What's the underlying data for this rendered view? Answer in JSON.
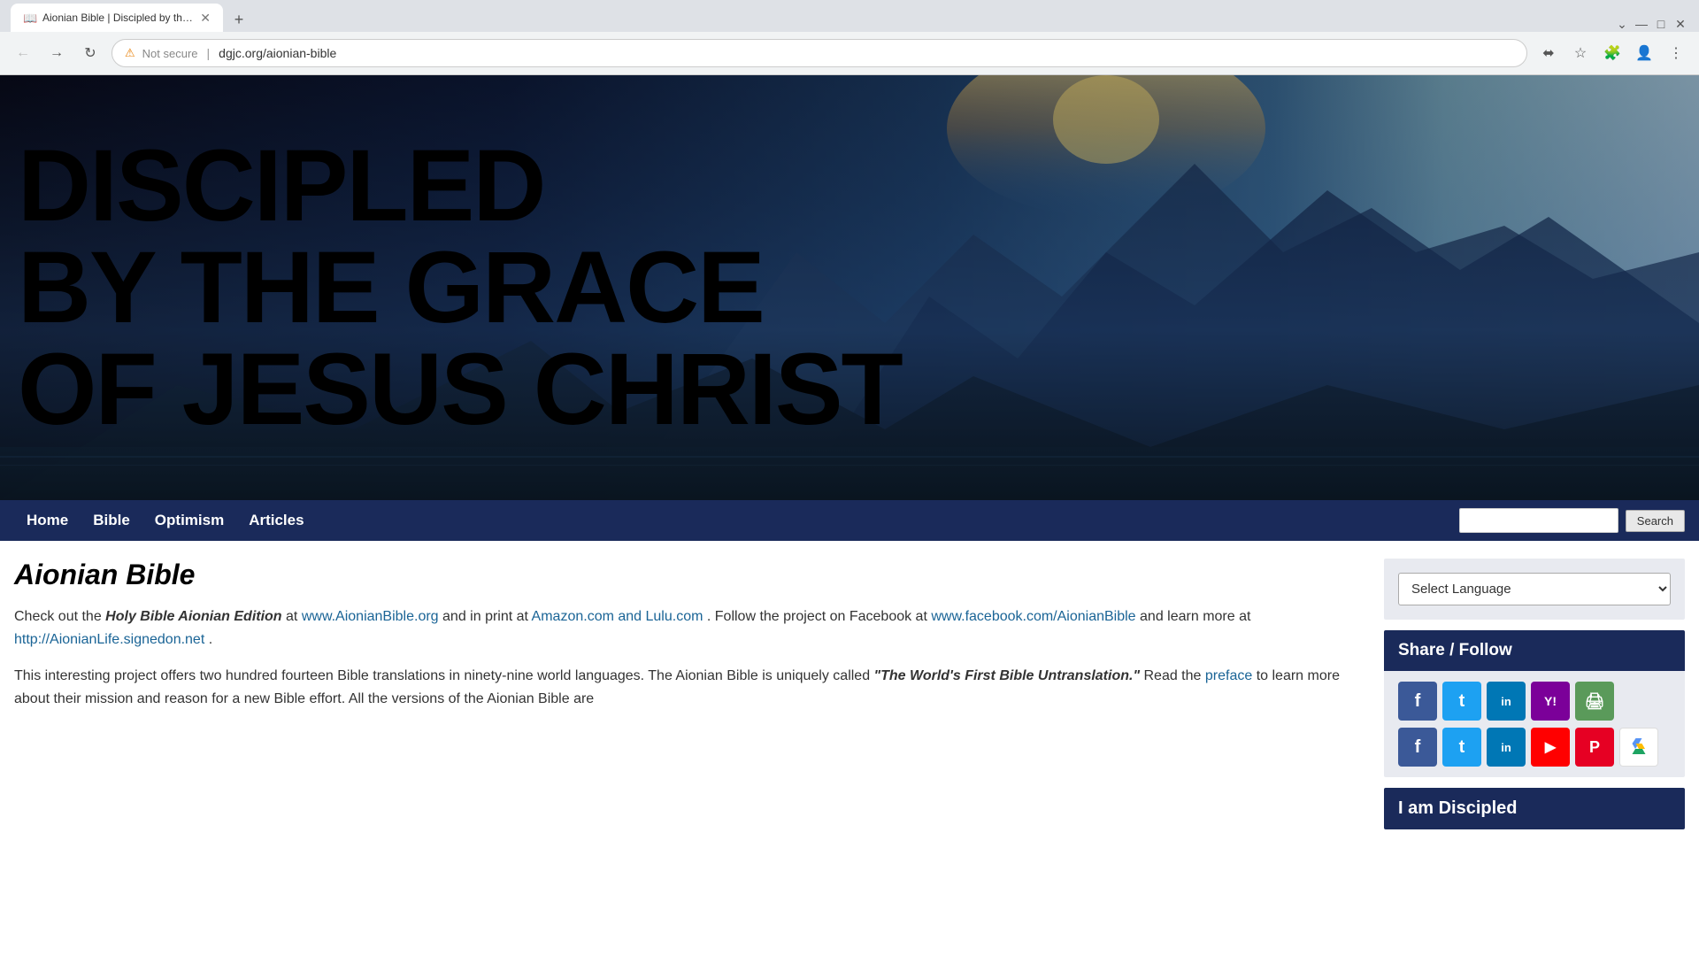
{
  "browser": {
    "tab_title": "Aionian Bible | Discipled by the C",
    "tab_favicon": "📖",
    "url": "dgjc.org/aionian-bible",
    "security_label": "Not secure",
    "new_tab_label": "+"
  },
  "nav": {
    "links": [
      "Home",
      "Bible",
      "Optimism",
      "Articles"
    ],
    "search_placeholder": "",
    "search_btn": "Search"
  },
  "hero": {
    "line1": "DISCIPLED",
    "line2": "BY THE GRACE",
    "line3": "OF JESUS CHRIST"
  },
  "page": {
    "title": "Aionian Bible",
    "para1_before_link1": "Check out the ",
    "para1_italic": "Holy Bible Aionian Edition",
    "para1_mid": " at ",
    "para1_link1": "www.AionianBible.org",
    "para1_mid2": " and in print at ",
    "para1_link2": "Amazon.com and Lulu.com",
    "para1_mid3": ".  Follow the project on Facebook at ",
    "para1_link3": "www.facebook.com/AionianBible",
    "para1_mid4": " and learn more at ",
    "para1_link4": "http://AionianLife.signedon.net",
    "para1_end": ".",
    "para2_start": "This interesting project offers two hundred fourteen Bible translations in ninety-nine world languages.  The Aionian Bible is uniquely called ",
    "para2_italic": "\"The World's First Bible Untranslation.\"",
    "para2_mid": "  Read the ",
    "para2_link": "preface",
    "para2_end": " to learn more about their mission and reason for a new Bible effort.  All the versions of the Aionian Bible are"
  },
  "sidebar": {
    "lang_select_label": "Select Language",
    "share_header": "Share / Follow",
    "discipled_header": "I am Discipled",
    "share_icons_row1": [
      {
        "name": "facebook",
        "label": "f",
        "class": "icon-fb"
      },
      {
        "name": "twitter",
        "label": "t",
        "class": "icon-tw"
      },
      {
        "name": "linkedin",
        "label": "in",
        "class": "icon-li"
      },
      {
        "name": "yahoo",
        "label": "Y!",
        "class": "icon-yh"
      },
      {
        "name": "print",
        "label": "🖨",
        "class": "icon-print"
      }
    ],
    "share_icons_row2": [
      {
        "name": "facebook2",
        "label": "f",
        "class": "icon-fb2"
      },
      {
        "name": "twitter2",
        "label": "t",
        "class": "icon-tw2"
      },
      {
        "name": "linkedin2",
        "label": "in",
        "class": "icon-li2"
      },
      {
        "name": "youtube",
        "label": "▶",
        "class": "icon-yt"
      },
      {
        "name": "pinterest",
        "label": "P",
        "class": "icon-pin"
      },
      {
        "name": "drive",
        "label": "△",
        "class": "icon-drive"
      }
    ]
  }
}
